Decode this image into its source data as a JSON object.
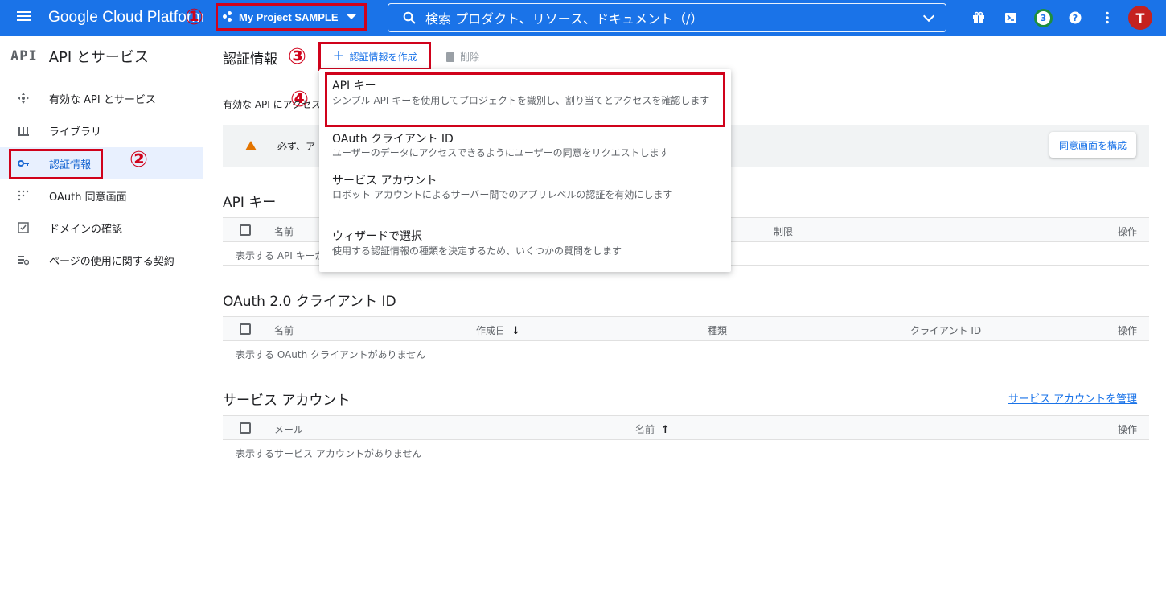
{
  "topbar": {
    "brand": "Google Cloud Platform",
    "project_label": "My Project SAMPLE",
    "search_placeholder": "検索  プロダクト、リソース、ドキュメント（/）",
    "notification_count": "3",
    "avatar_letter": "T"
  },
  "annotations": {
    "n1": "①",
    "n2": "②",
    "n3": "③",
    "n4": "④"
  },
  "sidebar": {
    "api_mark": "API",
    "title": "API とサービス",
    "items": [
      {
        "label": "有効な API とサービス",
        "icon": "move-icon"
      },
      {
        "label": "ライブラリ",
        "icon": "library-icon"
      },
      {
        "label": "認証情報",
        "icon": "key-icon"
      },
      {
        "label": "OAuth 同意画面",
        "icon": "grid-dots-icon"
      },
      {
        "label": "ドメインの確認",
        "icon": "checkbox-icon"
      },
      {
        "label": "ページの使用に関する契約",
        "icon": "settings-list-icon"
      }
    ]
  },
  "main": {
    "title": "認証情報",
    "create_label": "認証情報を作成",
    "delete_label": "削除",
    "intro": "有効な API にアクセスするには認証情報を作成します。",
    "warning": "必ず、ア",
    "consent_button": "同意画面を構成"
  },
  "api_keys": {
    "title": "API キー",
    "columns": [
      "名前",
      "制限",
      "操作"
    ],
    "empty": "表示する API キーがありません"
  },
  "oauth": {
    "title": "OAuth 2.0 クライアント ID",
    "columns": [
      "名前",
      "作成日",
      "種類",
      "クライアント ID",
      "操作"
    ],
    "sort_arrow": "↓",
    "empty": "表示する OAuth クライアントがありません"
  },
  "service_accounts": {
    "title": "サービス アカウント",
    "manage_link": "サービス アカウントを管理",
    "columns": [
      "メール",
      "名前",
      "操作"
    ],
    "sort_arrow": "↑",
    "empty": "表示するサービス アカウントがありません"
  },
  "dropdown": {
    "items": [
      {
        "title": "API キー",
        "desc": "シンプル API キーを使用してプロジェクトを識別し、割り当てとアクセスを確認します"
      },
      {
        "title": "OAuth クライアント ID",
        "desc": "ユーザーのデータにアクセスできるようにユーザーの同意をリクエストします"
      },
      {
        "title": "サービス アカウント",
        "desc": "ロボット アカウントによるサーバー間でのアプリレベルの認証を有効にします"
      },
      {
        "title": "ウィザードで選択",
        "desc": "使用する認証情報の種類を決定するため、いくつかの質問をします"
      }
    ]
  },
  "colors": {
    "primary": "#1a73e8",
    "annotation": "#d0021b",
    "warning": "#e37400"
  }
}
